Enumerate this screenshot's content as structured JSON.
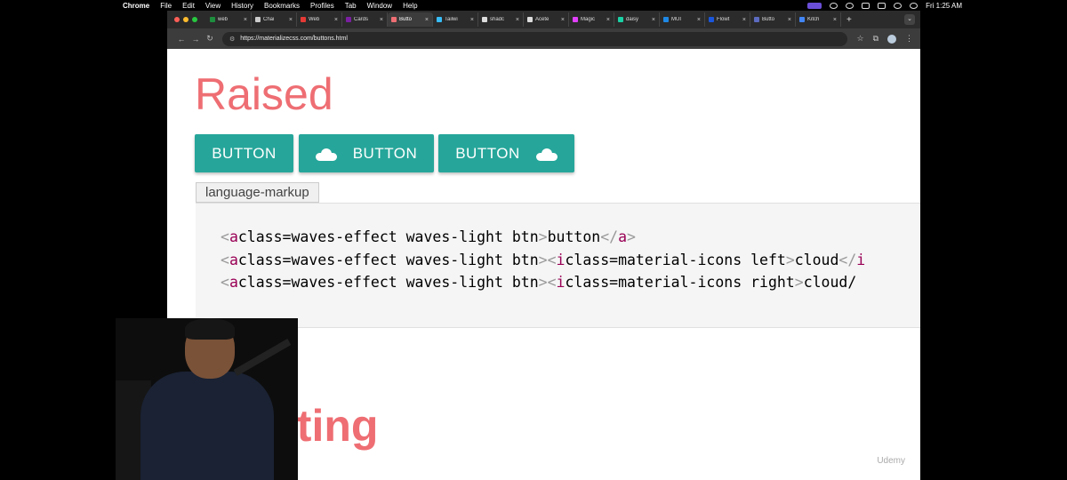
{
  "menubar": {
    "app": "Chrome",
    "items": [
      "File",
      "Edit",
      "View",
      "History",
      "Bookmarks",
      "Profiles",
      "Tab",
      "Window",
      "Help"
    ],
    "clock": "Fri 1:25 AM"
  },
  "browser": {
    "tabs": [
      {
        "label": "web",
        "color": "#1e8e3e"
      },
      {
        "label": "Chai",
        "color": "#cccccc"
      },
      {
        "label": "Web",
        "color": "#e53935"
      },
      {
        "label": "Cards",
        "color": "#7b1fa2"
      },
      {
        "label": "Butto",
        "color": "#ee6e73",
        "active": true
      },
      {
        "label": "Tailwi",
        "color": "#38bdf8"
      },
      {
        "label": "shadc",
        "color": "#dddddd"
      },
      {
        "label": "Acete",
        "color": "#dddddd"
      },
      {
        "label": "Magic",
        "color": "#e040fb"
      },
      {
        "label": "daisy",
        "color": "#1ad1a5"
      },
      {
        "label": "MUI",
        "color": "#1e88e5"
      },
      {
        "label": "Flowt",
        "color": "#1a56db"
      },
      {
        "label": "Butto",
        "color": "#5c6bc0"
      },
      {
        "label": "Kitch",
        "color": "#4285f4"
      }
    ],
    "url": "https://materializecss.com/buttons.html"
  },
  "page": {
    "heading_raised": "Raised",
    "buttons": [
      {
        "label": "BUTTON",
        "icon": "none"
      },
      {
        "label": "BUTTON",
        "icon": "cloud-left"
      },
      {
        "label": "BUTTON",
        "icon": "cloud-right"
      }
    ],
    "lang_tag": "language-markup",
    "code_lines": [
      "<a class=\"waves-effect waves-light btn\">button</a>",
      "<a class=\"waves-effect waves-light btn\"><i class=\"material-icons left\">cloud</i",
      "<a class=\"waves-effect waves-light btn\"><i class=\"material-icons right\">cloud</"
    ],
    "selected_text": "waves-effect waves-light btn",
    "heading_floating": "ating"
  },
  "watermark": "Udemy",
  "colors": {
    "accent": "#ee6e73",
    "button": "#26a69a"
  }
}
